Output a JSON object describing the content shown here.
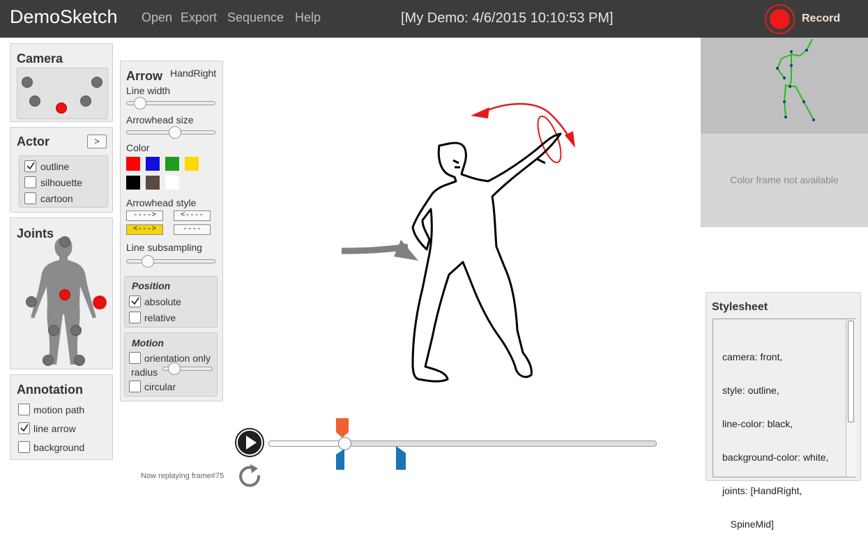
{
  "app": {
    "title": "DemoSketch",
    "doc_title": "[My Demo: 4/6/2015 10:10:53 PM]",
    "record_label": "Record"
  },
  "menu": [
    "Open",
    "Export",
    "Sequence",
    "Help"
  ],
  "camera": {
    "title": "Camera"
  },
  "actor": {
    "title": "Actor",
    "next_label": ">",
    "options": [
      {
        "label": "outline",
        "checked": true
      },
      {
        "label": "silhouette",
        "checked": false
      },
      {
        "label": "cartoon",
        "checked": false
      }
    ]
  },
  "joints": {
    "title": "Joints"
  },
  "annotation": {
    "title": "Annotation",
    "options": [
      {
        "label": "motion path",
        "checked": false
      },
      {
        "label": "line arrow",
        "checked": true
      },
      {
        "label": "background",
        "checked": false
      }
    ]
  },
  "arrow": {
    "title": "Arrow",
    "joint": "HandRight",
    "line_width_label": "Line width",
    "line_width": 0.1,
    "arrowhead_size_label": "Arrowhead size",
    "arrowhead_size": 0.55,
    "color_label": "Color",
    "colors": [
      "#ff0000",
      "#1010dd",
      "#1e9e1e",
      "#ffd700",
      "#000000",
      "#5a4a44",
      "#ffffff"
    ],
    "arrowhead_style_label": "Arrowhead style",
    "styles": [
      "---->",
      "<----",
      "<--->",
      "----"
    ],
    "selected_style": 2,
    "subsampling_label": "Line subsampling",
    "subsampling": 0.2,
    "position": {
      "title": "Position",
      "options": [
        {
          "label": "absolute",
          "checked": true
        },
        {
          "label": "relative",
          "checked": false
        }
      ]
    },
    "motion": {
      "title": "Motion",
      "orientation_label": "orientation only",
      "orientation_checked": false,
      "radius_label": "radius",
      "radius": 0.15,
      "circular_label": "circular",
      "circular_checked": false
    }
  },
  "camera_view": {
    "no_color": "Color frame not available"
  },
  "stylesheet": {
    "title": "Stylesheet",
    "lines": [
      "camera: front,",
      "style: outline,",
      "line-color: black,",
      "background-color: white,",
      "joints: [HandRight,",
      "   SpineMid]"
    ]
  },
  "playback": {
    "status": "Now replaying frame#75",
    "progress": 0.19
  },
  "colors": {
    "accent_red": "#f01818",
    "marker_orange": "#f06030",
    "marker_blue": "#1a74b6",
    "topbar": "#3c3c3c"
  }
}
